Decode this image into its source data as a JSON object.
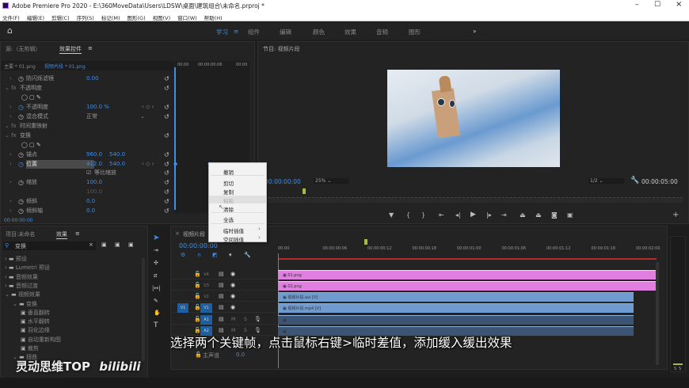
{
  "window": {
    "title": "Adobe Premiere Pro 2020 - E:\\360MoveData\\Users\\LDSW\\桌面\\建筑组合\\未命名.prproj *",
    "minimize": "–",
    "maximize": "☐",
    "close": "×"
  },
  "menu": [
    "文件(F)",
    "编辑(E)",
    "剪辑(C)",
    "序列(S)",
    "标记(M)",
    "图形(G)",
    "视图(V)",
    "窗口(W)",
    "帮助(H)"
  ],
  "workspaces": {
    "items": [
      "学习",
      "组件",
      "编辑",
      "颜色",
      "效果",
      "音频",
      "图形"
    ],
    "active": "学习",
    "more": "»"
  },
  "effect_controls": {
    "tabs": [
      "源:（无剪辑）",
      "效果控件"
    ],
    "master": "主要 * 01.png",
    "clip": "视频片段 * 01.png",
    "ruler": [
      "00:00",
      "00:00:00:06",
      "00:00"
    ],
    "rows": [
      {
        "label": "防闪烁滤镜",
        "v1": "0.00"
      },
      {
        "label": "不透明度",
        "fx": true
      },
      {
        "label": "不透明度",
        "v1": "100.0 %"
      },
      {
        "label": "混合模式",
        "v1": "正常"
      },
      {
        "label": "时间重映射",
        "fx": true
      },
      {
        "label": "变换",
        "fx": true
      },
      {
        "label": "锚点",
        "v1": "960.0",
        "v2": "540.0"
      },
      {
        "label": "位置",
        "v1": "412.0",
        "v2": "540.0"
      },
      {
        "label": "",
        "v1": "等比缩放"
      },
      {
        "label": "缩放",
        "v1": "100.0"
      },
      {
        "label": "",
        "v1": "100.0"
      },
      {
        "label": "倾斜",
        "v1": "0.0"
      },
      {
        "label": "倾斜轴",
        "v1": "0.0"
      }
    ],
    "timecode": "00:00:00:00"
  },
  "context_menu": {
    "items": [
      {
        "label": "撤销"
      },
      {
        "label": "剪切"
      },
      {
        "label": "复制"
      },
      {
        "label": "粘贴",
        "disabled": true
      },
      {
        "label": "清除"
      },
      {
        "label": "全选"
      },
      {
        "label": "临时插值",
        "submenu": true
      },
      {
        "label": "空间插值",
        "submenu": true
      }
    ]
  },
  "program": {
    "title": "节目: 视频片段",
    "timecode": "00:00:00:00",
    "zoom": "25%",
    "resolution": "1/2",
    "duration": "00:00:05:00"
  },
  "project": {
    "tabs": [
      "项目:未命名",
      "效果"
    ],
    "search": "变换",
    "tree": [
      {
        "label": "预设",
        "level": 0
      },
      {
        "label": "Lumetri 预设",
        "level": 0
      },
      {
        "label": "音频效果",
        "level": 0
      },
      {
        "label": "音频过渡",
        "level": 0
      },
      {
        "label": "视频效果",
        "level": 0,
        "open": true
      },
      {
        "label": "变换",
        "level": 1,
        "open": true
      },
      {
        "label": "垂直翻转",
        "level": 2
      },
      {
        "label": "水平翻转",
        "level": 2
      },
      {
        "label": "羽化边缘",
        "level": 2
      },
      {
        "label": "自动重新构图",
        "level": 2
      },
      {
        "label": "裁剪",
        "level": 2
      },
      {
        "label": "扭曲",
        "level": 1,
        "open": true
      }
    ]
  },
  "timeline": {
    "tab": "视频片段",
    "timecode": "00:00:00:00",
    "ruler": [
      "00:00",
      "00:00:00:06",
      "00:00:00:12",
      "00:00:00:18",
      "00:00:01:00",
      "00:00:01:06",
      "00:00:01:12",
      "00:00:01:18",
      "00:00:02:00"
    ],
    "tracks": [
      {
        "name": "V4",
        "clip": "01.png",
        "color": "#e07fe0"
      },
      {
        "name": "V3",
        "clip": "02.png",
        "color": "#e07fe0"
      },
      {
        "name": "V2",
        "clip": "视频片段.avi [V]",
        "color": "#6f9bd1"
      },
      {
        "name": "V1",
        "src": "V1",
        "clip": "视频片段.mp4 [V]",
        "color": "#6f9bd1"
      },
      {
        "name": "A1",
        "m": "M",
        "s": "S",
        "color": "#3d5574"
      },
      {
        "name": "A2",
        "m": "M",
        "s": "S",
        "color": "#3d5574"
      }
    ],
    "master": "主声道",
    "master_val": "0.0"
  },
  "meter": {
    "labels": [
      "S",
      "S"
    ]
  },
  "subtitle": "选择两个关键帧，点击鼠标右键>临时差值，添加缓入缓出效果",
  "watermark": {
    "text": "灵动思维TOP",
    "logo": "bilibili"
  }
}
